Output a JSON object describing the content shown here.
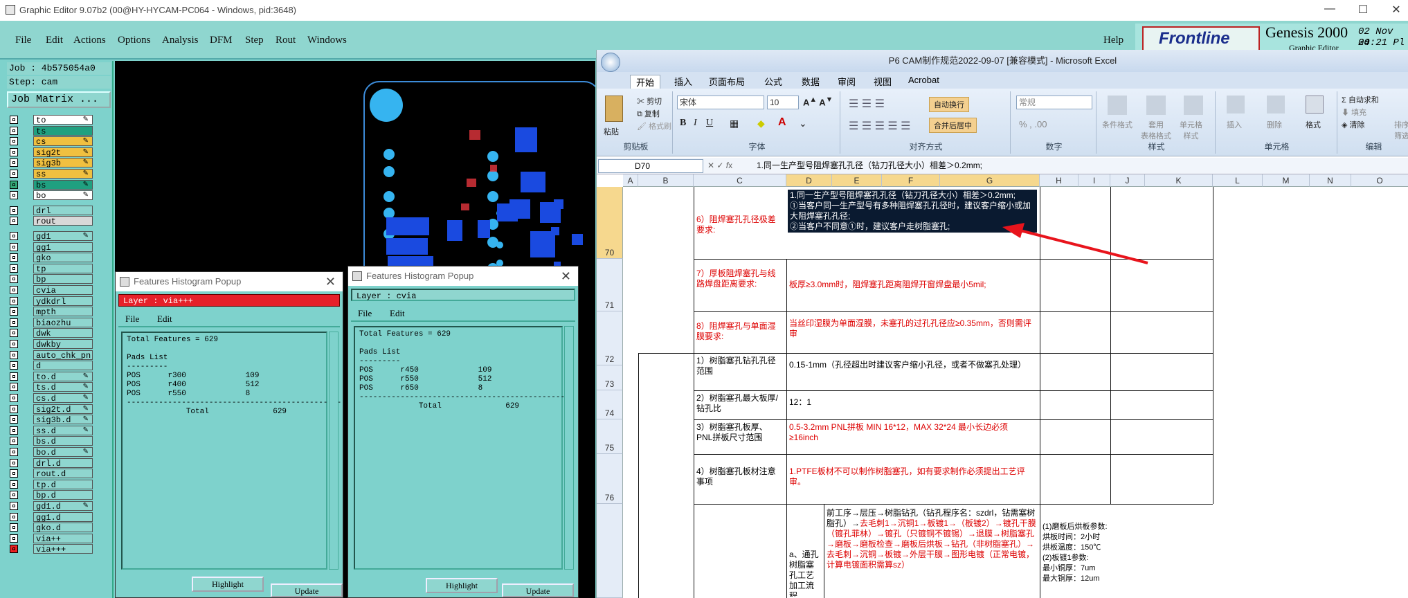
{
  "genesis": {
    "window_title": "Graphic Editor 9.07b2 (00@HY-HYCAM-PC064 - Windows, pid:3648)",
    "menu": [
      "File",
      "Edit",
      "Actions",
      "Options",
      "Analysis",
      "DFM",
      "Step",
      "Rout",
      "Windows"
    ],
    "help": "Help",
    "brand": "Frontline",
    "product": "Genesis 2000",
    "subtitle": "Graphic Editor",
    "date": "02 Nov 20",
    "time": "04:21 Pl",
    "job": "Job : 4b575054a0",
    "step": "Step: cam",
    "job_matrix": "Job Matrix ...",
    "layers": [
      {
        "name": "to",
        "color": "#ffffff",
        "edit": "✎"
      },
      {
        "name": "ts",
        "color": "#20a080",
        "edit": ""
      },
      {
        "name": "cs",
        "color": "#f0c040",
        "edit": "✎"
      },
      {
        "name": "sig2t",
        "color": "#f0c040",
        "edit": "✎"
      },
      {
        "name": "sig3b",
        "color": "#f0c040",
        "edit": "✎"
      },
      {
        "name": "ss",
        "color": "#f0c040",
        "edit": "✎"
      },
      {
        "name": "bs",
        "color": "#20a080",
        "edit": "✎"
      },
      {
        "name": "bo",
        "color": "#ffffff",
        "edit": "✎"
      },
      {
        "name": "drl",
        "color": "#8fd6cf",
        "edit": ""
      },
      {
        "name": "rout",
        "color": "#d8d8d8",
        "edit": ""
      },
      {
        "name": "gd1",
        "color": "#8fd6cf",
        "edit": "✎"
      },
      {
        "name": "gg1",
        "color": "#8fd6cf",
        "edit": ""
      },
      {
        "name": "gko",
        "color": "#8fd6cf",
        "edit": ""
      },
      {
        "name": "tp",
        "color": "#8fd6cf",
        "edit": ""
      },
      {
        "name": "bp",
        "color": "#8fd6cf",
        "edit": ""
      },
      {
        "name": "cvia",
        "color": "#8fd6cf",
        "edit": ""
      },
      {
        "name": "ydkdrl",
        "color": "#8fd6cf",
        "edit": ""
      },
      {
        "name": "mpth",
        "color": "#8fd6cf",
        "edit": ""
      },
      {
        "name": "biaozhu",
        "color": "#8fd6cf",
        "edit": ""
      },
      {
        "name": "dwk",
        "color": "#8fd6cf",
        "edit": ""
      },
      {
        "name": "dwkby",
        "color": "#8fd6cf",
        "edit": ""
      },
      {
        "name": "auto_chk_pn",
        "color": "#8fd6cf",
        "edit": ""
      },
      {
        "name": "d",
        "color": "#8fd6cf",
        "edit": ""
      },
      {
        "name": "to.d",
        "color": "#8fd6cf",
        "edit": "✎"
      },
      {
        "name": "ts.d",
        "color": "#8fd6cf",
        "edit": "✎"
      },
      {
        "name": "cs.d",
        "color": "#8fd6cf",
        "edit": "✎"
      },
      {
        "name": "sig2t.d",
        "color": "#8fd6cf",
        "edit": "✎"
      },
      {
        "name": "sig3b.d",
        "color": "#8fd6cf",
        "edit": "✎"
      },
      {
        "name": "ss.d",
        "color": "#8fd6cf",
        "edit": "✎"
      },
      {
        "name": "bs.d",
        "color": "#8fd6cf",
        "edit": ""
      },
      {
        "name": "bo.d",
        "color": "#8fd6cf",
        "edit": "✎"
      },
      {
        "name": "drl.d",
        "color": "#8fd6cf",
        "edit": ""
      },
      {
        "name": "rout.d",
        "color": "#8fd6cf",
        "edit": ""
      },
      {
        "name": "tp.d",
        "color": "#8fd6cf",
        "edit": ""
      },
      {
        "name": "bp.d",
        "color": "#8fd6cf",
        "edit": ""
      },
      {
        "name": "gd1.d",
        "color": "#8fd6cf",
        "edit": "✎"
      },
      {
        "name": "gg1.d",
        "color": "#8fd6cf",
        "edit": ""
      },
      {
        "name": "gko.d",
        "color": "#8fd6cf",
        "edit": ""
      },
      {
        "name": "via++",
        "color": "#8fd6cf",
        "edit": ""
      },
      {
        "name": "via+++",
        "color": "#8fd6cf",
        "edit": ""
      }
    ],
    "popup1": {
      "title": "Features Histogram Popup",
      "layer": "Layer :  via+++",
      "menu": [
        "File",
        "Edit"
      ],
      "text": "Total Features = 629\n\nPads List\n---------\nPOS      r300             109\nPOS      r400             512\nPOS      r550             8\n-----------------------------------------------\n             Total              629",
      "btn1": "Highlight",
      "btn2": "Update"
    },
    "popup2": {
      "title": "Features Histogram Popup",
      "layer": "Layer :  cvia",
      "menu": [
        "File",
        "Edit"
      ],
      "text": "Total Features = 629\n\nPads List\n---------\nPOS      r450             109\nPOS      r550             512\nPOS      r650             8\n-----------------------------------------------\n             Total              629",
      "btn1": "Highlight",
      "btn2": "Update"
    }
  },
  "excel": {
    "title": "P6 CAM制作规范2022-09-07  [兼容模式] - Microsoft Excel",
    "tabs": [
      "开始",
      "插入",
      "页面布局",
      "公式",
      "数据",
      "审阅",
      "视图",
      "Acrobat"
    ],
    "clipboard": {
      "paste": "粘贴",
      "cut": "剪切",
      "copy": "复制",
      "format_painter": "格式刷",
      "label": "剪贴板"
    },
    "font": {
      "name": "宋体",
      "size": "10",
      "label": "字体"
    },
    "align": {
      "wrap": "自动换行",
      "merge": "合并后居中",
      "label": "对齐方式"
    },
    "number": {
      "format": "常规",
      "label": "数字"
    },
    "styles": {
      "cond": "条件格式",
      "table": "套用\n表格格式",
      "cell": "单元格\n样式",
      "label": "样式"
    },
    "cells": {
      "insert": "插入",
      "delete": "删除",
      "format": "格式",
      "label": "单元格"
    },
    "editing": {
      "autosum": "自动求和",
      "fill": "填充",
      "clear": "清除",
      "sort": "排序和\n筛选",
      "find": "查找\n选",
      "label": "编辑"
    },
    "name_box": "D70",
    "formula": "1.同一生产型号阻焊塞孔孔径（钻刀孔径大小）相差＞0.2mm;",
    "columns": [
      "A",
      "B",
      "C",
      "D",
      "E",
      "F",
      "G",
      "H",
      "I",
      "J",
      "K",
      "L",
      "M",
      "N",
      "O"
    ],
    "rows": [
      "70",
      "71",
      "72",
      "73",
      "74",
      "75",
      "76"
    ],
    "r70_label": "6）阻焊塞孔孔径极差要求:",
    "r70_sel": [
      "1.同一生产型号阻焊塞孔孔径（钻刀孔径大小）相差＞0.2mm;",
      "①当客户同一生产型号有多种阻焊塞孔孔径时，建议客户缩小或加大阻焊塞孔孔径;",
      "②当客户不同意①时，建议客户走树脂塞孔;"
    ],
    "r71_label": "7）厚板阻焊塞孔与线路焊盘距离要求:",
    "r71_val": "板厚≥3.0mm时，阻焊塞孔距离阻焊开窗焊盘最小5mil;",
    "r72_label": "8）阻焊塞孔与单面湿膜要求:",
    "r72_val": "当丝印湿膜为单面湿膜，未塞孔的过孔孔径应≥0.35mm，否则需评审",
    "r73_label": "1）树脂塞孔钻孔孔径范围",
    "r73_val": "0.15-1mm（孔径超出时建议客户缩小孔径，或者不做塞孔处理）",
    "r74_label": "2）树脂塞孔最大板厚/钻孔比",
    "r74_val": "12：1",
    "r75_label": "3）树脂塞孔板厚、PNL拼板尺寸范围",
    "r75_val": "0.5-3.2mm  PNL拼板  MIN 16*12，MAX 32*24  最小长边必须≥16inch",
    "r76_label": "4）树脂塞孔板材注意事项",
    "r76_val": "1.PTFE板材不可以制作树脂塞孔，如有要求制作必须提出工艺评审。",
    "r77_label": "a、通孔树脂塞孔工艺加工流程",
    "r77_flow": "前工序→层压→树脂钻孔（钻孔程序名：szdrl，钻需塞树脂孔）→去毛刺1→沉铜1→板镀1→（板镀2）→镀孔干膜（镀孔菲林）→镀孔（只镀铜不镀锡）→退膜→树脂塞孔→磨板→磨板检查→磨板后烘板→钻孔（非树脂塞孔）→去毛刺→沉铜→板镀→外层干膜→图形电镀（正常电镀，计算电镀面积需算sz）",
    "r77_params": "(1)磨板后烘板参数:\n烘板时间：2小时\n烘板温度：150℃\n(2)板镀1参数:\n最小铜厚：7um\n最大铜厚：12um"
  }
}
